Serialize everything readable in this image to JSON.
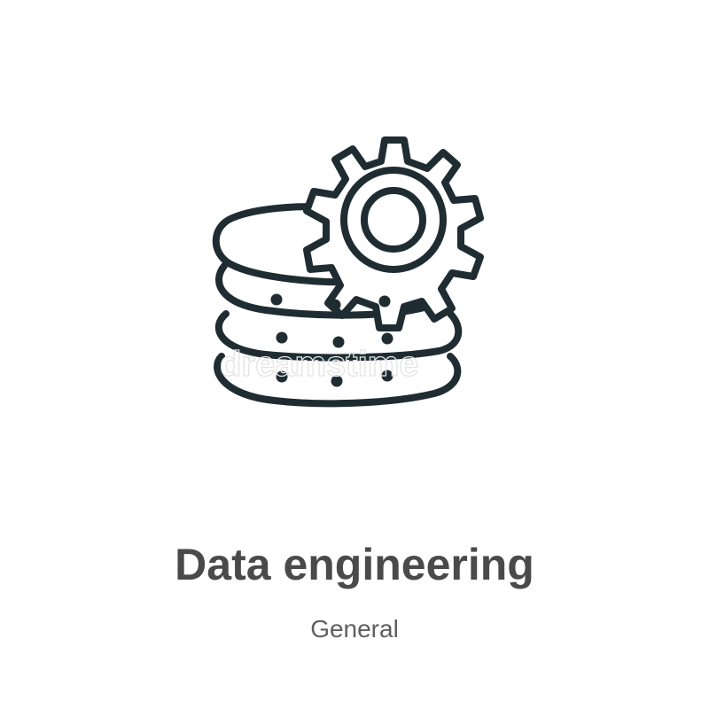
{
  "icon": {
    "name": "data-engineering-icon",
    "stroke_color": "#1f2d33"
  },
  "watermark": "dreamstime",
  "title": "Data engineering",
  "category": "General"
}
